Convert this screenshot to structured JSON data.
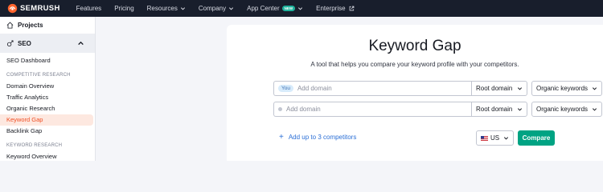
{
  "brand": {
    "name": "SEMRUSH",
    "accent": "#ff642d"
  },
  "topnav": {
    "items": [
      {
        "label": "Features",
        "dropdown": false
      },
      {
        "label": "Pricing",
        "dropdown": false
      },
      {
        "label": "Resources",
        "dropdown": true
      },
      {
        "label": "Company",
        "dropdown": true
      },
      {
        "label": "App Center",
        "dropdown": true,
        "badge": "NEW"
      },
      {
        "label": "Enterprise",
        "external": true
      }
    ]
  },
  "sidebar": {
    "projects": "Projects",
    "seo": "SEO",
    "dashboard": "SEO Dashboard",
    "sections": [
      {
        "title": "COMPETITIVE RESEARCH",
        "items": [
          "Domain Overview",
          "Traffic Analytics",
          "Organic Research",
          "Keyword Gap",
          "Backlink Gap"
        ]
      },
      {
        "title": "KEYWORD RESEARCH",
        "items": [
          "Keyword Overview"
        ]
      }
    ],
    "active": "Keyword Gap"
  },
  "main": {
    "title": "Keyword Gap",
    "subtitle": "A tool that helps you compare your keyword profile with your competitors.",
    "rows": [
      {
        "tag": "You",
        "placeholder": "Add domain",
        "scope": "Root domain",
        "type": "Organic keywords"
      },
      {
        "tag": "",
        "placeholder": "Add domain",
        "scope": "Root domain",
        "type": "Organic keywords"
      }
    ],
    "add_competitors": "Add up to 3 competitors",
    "country": "US",
    "compare": "Compare"
  },
  "colors": {
    "nav_bg": "#181e2c",
    "compare_bg": "#00a383",
    "active_bg": "#fde8e0",
    "active_text": "#f04e23",
    "link": "#2b6fd6"
  }
}
